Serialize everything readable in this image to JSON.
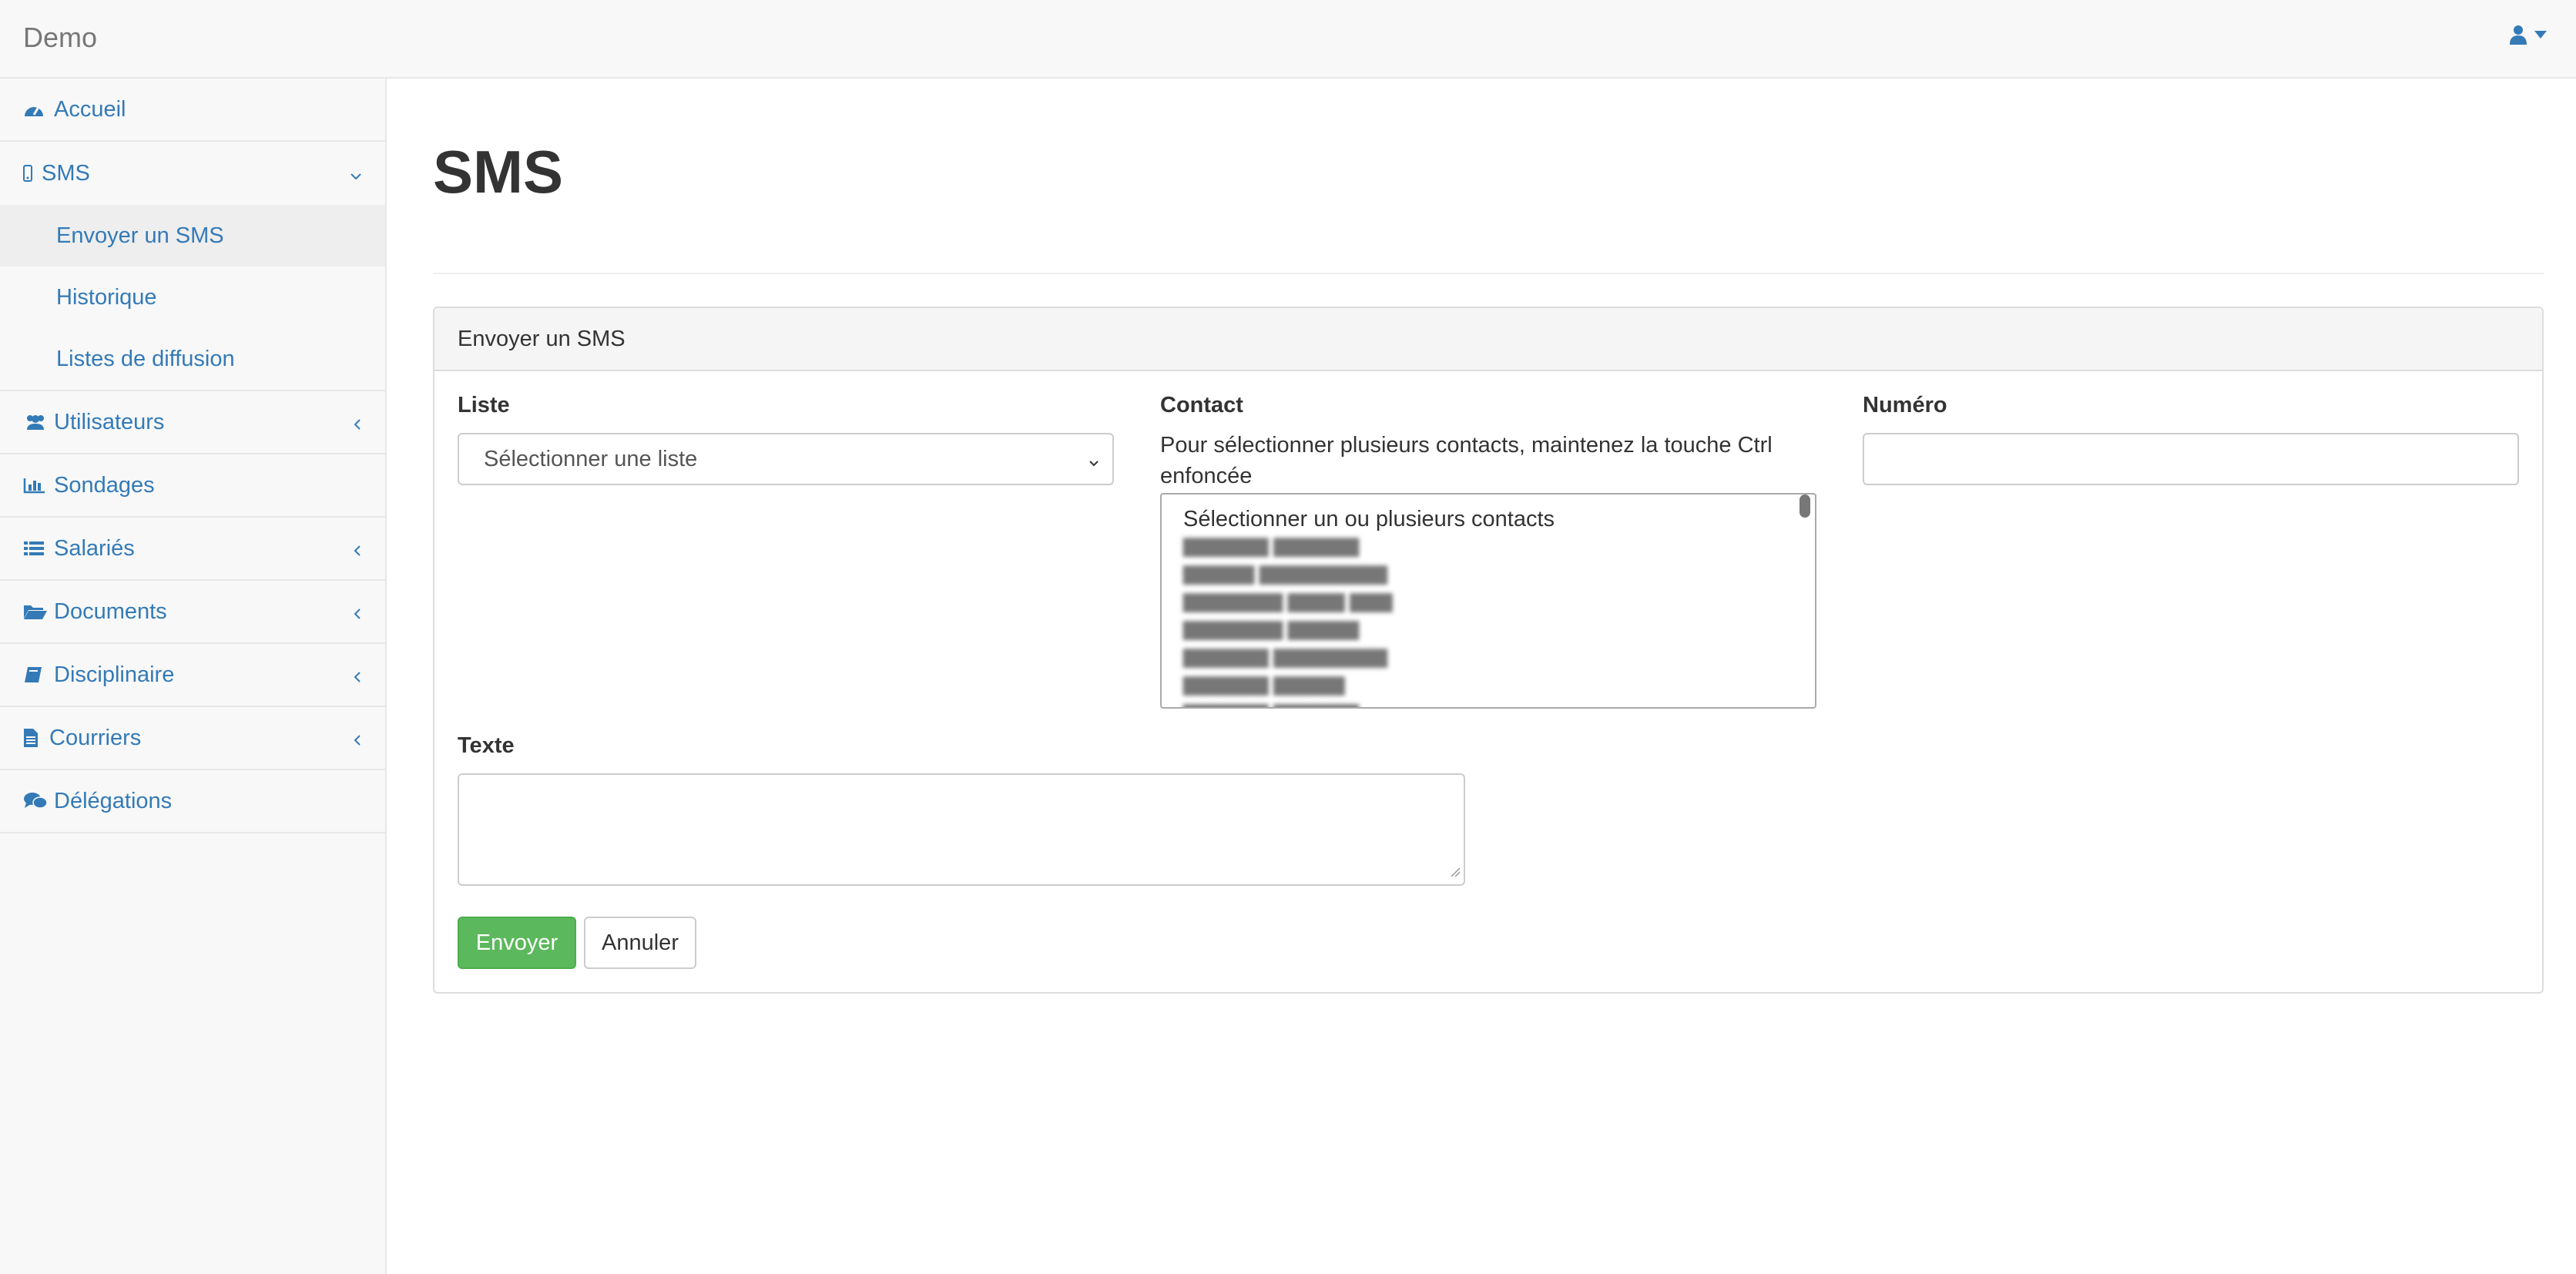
{
  "brand": "Demo",
  "user_menu": {
    "icon": "user-icon"
  },
  "sidebar": {
    "items": [
      {
        "label": "Accueil",
        "icon": "dashboard-icon"
      },
      {
        "label": "SMS",
        "icon": "mobile-icon",
        "expanded": true,
        "children": [
          {
            "label": "Envoyer un SMS",
            "active": true
          },
          {
            "label": "Historique"
          },
          {
            "label": "Listes de diffusion"
          }
        ]
      },
      {
        "label": "Utilisateurs",
        "icon": "users-icon"
      },
      {
        "label": "Sondages",
        "icon": "bar-chart-icon"
      },
      {
        "label": "Salariés",
        "icon": "list-icon"
      },
      {
        "label": "Documents",
        "icon": "folder-open-icon"
      },
      {
        "label": "Disciplinaire",
        "icon": "book-icon"
      },
      {
        "label": "Courriers",
        "icon": "file-text-icon"
      },
      {
        "label": "Délégations",
        "icon": "comments-icon"
      }
    ]
  },
  "main": {
    "title": "SMS",
    "panel": {
      "heading": "Envoyer un SMS",
      "liste": {
        "label": "Liste",
        "selected": "Sélectionner une liste"
      },
      "contact": {
        "label": "Contact",
        "help": "Pour sélectionner plusieurs contacts, maintenez la touche Ctrl enfoncée",
        "placeholder_option": "Sélectionner un ou plusieurs contacts"
      },
      "numero": {
        "label": "Numéro",
        "value": ""
      },
      "texte": {
        "label": "Texte",
        "value": ""
      },
      "buttons": {
        "submit": "Envoyer",
        "cancel": "Annuler"
      }
    }
  },
  "colors": {
    "link": "#337ab7",
    "success": "#5cb85c"
  }
}
